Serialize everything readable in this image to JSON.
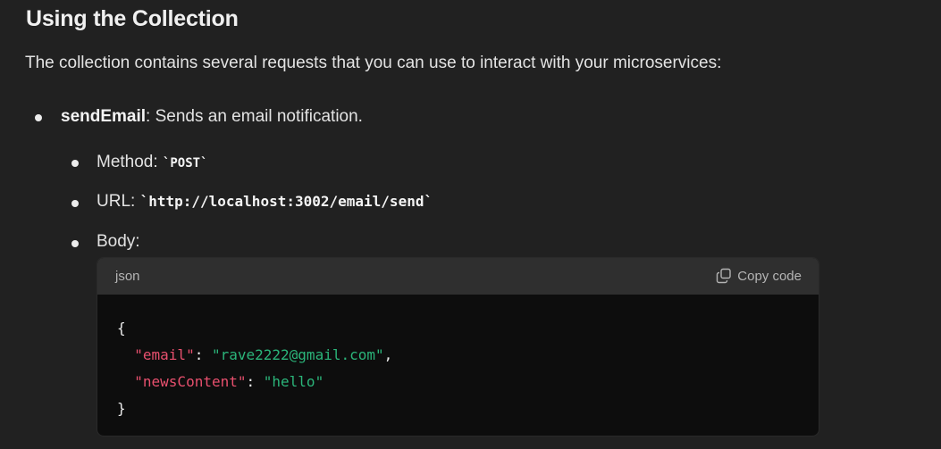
{
  "section": {
    "title": "Using the Collection",
    "intro": "The collection contains several requests that you can use to interact with your microservices:"
  },
  "request": {
    "name": "sendEmail",
    "description": ": Sends an email notification.",
    "method_label": "Method: ",
    "method_value": "`POST`",
    "url_label": "URL: ",
    "url_value": "`http://localhost:3002/email/send`",
    "body_label": "Body:"
  },
  "codeblock": {
    "language": "json",
    "copy_label": "Copy code",
    "copy_icon": "copy-icon",
    "lines": {
      "open": "{",
      "close": "}",
      "l1_indent": "  ",
      "l1_key": "\"email\"",
      "l1_sep": ": ",
      "l1_value": "\"rave2222@gmail.com\"",
      "l1_end": ",",
      "l2_indent": "  ",
      "l2_key": "\"newsContent\"",
      "l2_sep": ": ",
      "l2_value": "\"hello\""
    }
  },
  "colors": {
    "background": "#212121",
    "code_key": "#e8506e",
    "code_string": "#2bb57a",
    "code_bg": "#0d0d0d",
    "code_header_bg": "#2f2f2f"
  }
}
